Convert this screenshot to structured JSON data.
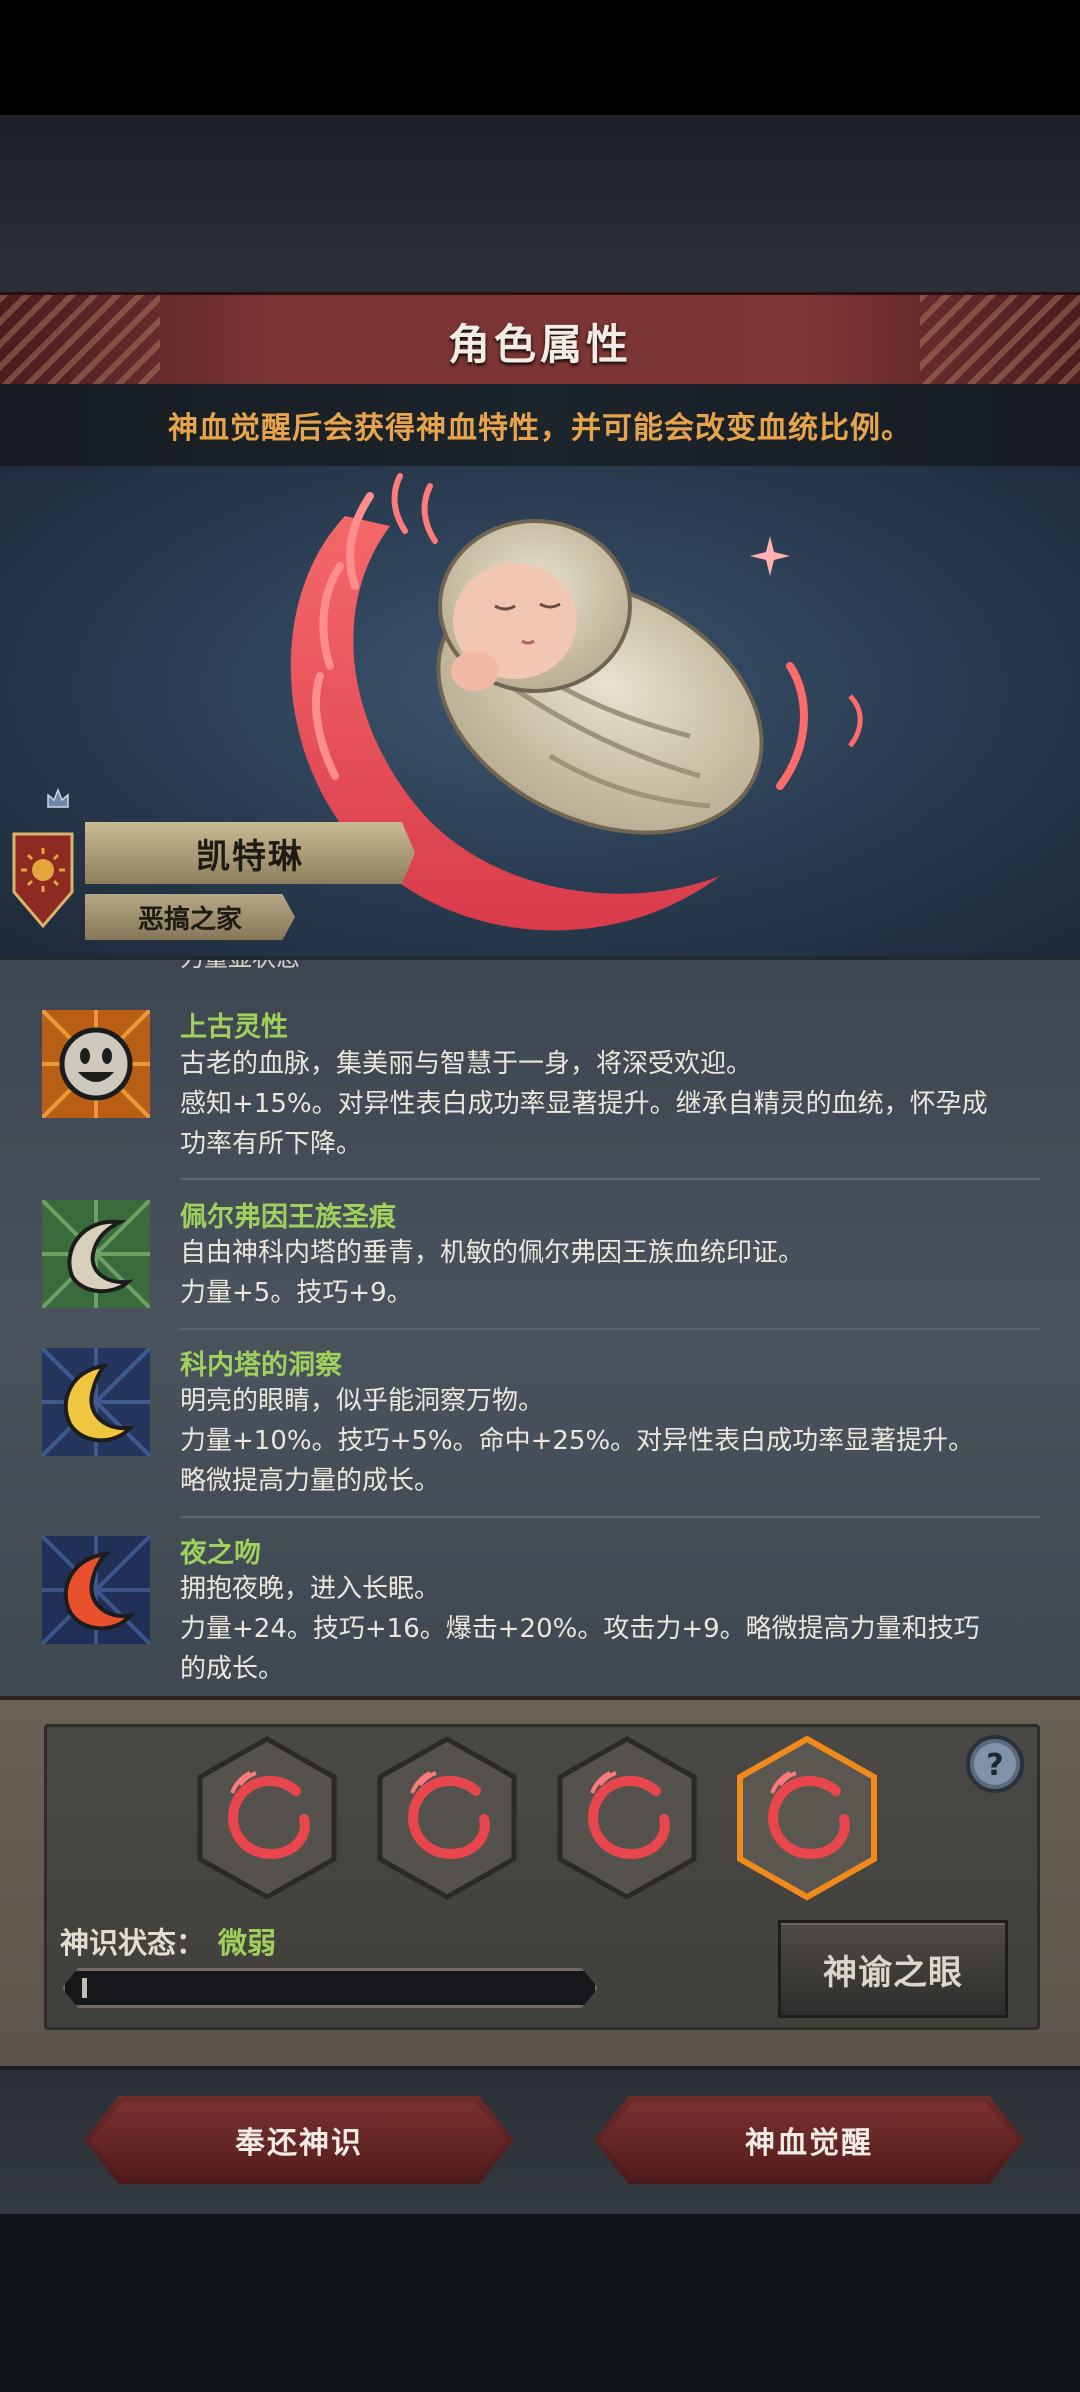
{
  "header": {
    "title": "角色属性",
    "subtitle": "神血觉醒后会获得神血特性，并可能会改变血统比例。"
  },
  "character": {
    "name": "凯特琳",
    "family": "恶搞之家"
  },
  "traits": {
    "cut_off_text": "力量显状态",
    "items": [
      {
        "name": "上古灵性",
        "icon": "smiley-icon",
        "line1": "古老的血脉，集美丽与智慧于一身，将深受欢迎。",
        "line2": "感知+15%。对异性表白成功率显著提升。继承自精灵的血统，怀孕成",
        "line3": "功率有所下降。"
      },
      {
        "name": "佩尔弗因王族圣痕",
        "icon": "white-flame-icon",
        "line1": "自由神科内塔的垂青，机敏的佩尔弗因王族血统印证。",
        "line2": "力量+5。技巧+9。"
      },
      {
        "name": "科内塔的洞察",
        "icon": "yellow-moon-icon",
        "line1": "明亮的眼睛，似乎能洞察万物。",
        "line2": "力量+10%。技巧+5%。命中+25%。对异性表白成功率显著提升。",
        "line3": "略微提高力量的成长。"
      },
      {
        "name": "夜之吻",
        "icon": "red-moon-icon",
        "line1": "拥抱夜晚，进入长眠。",
        "line2": "力量+24。技巧+16。爆击+20%。攻击力+9。略微提高力量和技巧",
        "line3": "的成长。"
      }
    ]
  },
  "consciousness": {
    "status_label": "神识状态：",
    "status_value": "微弱",
    "progress": 0.01,
    "oracle_button": "神谕之眼",
    "help": "?"
  },
  "actions": {
    "return_button": "奉还神识",
    "awaken_button": "神血觉醒"
  },
  "colors": {
    "accent_orange": "#e8a44b",
    "trait_green": "#9fd15c",
    "banner_red": "#7a3434",
    "selected_slot": "#f08a1c"
  }
}
